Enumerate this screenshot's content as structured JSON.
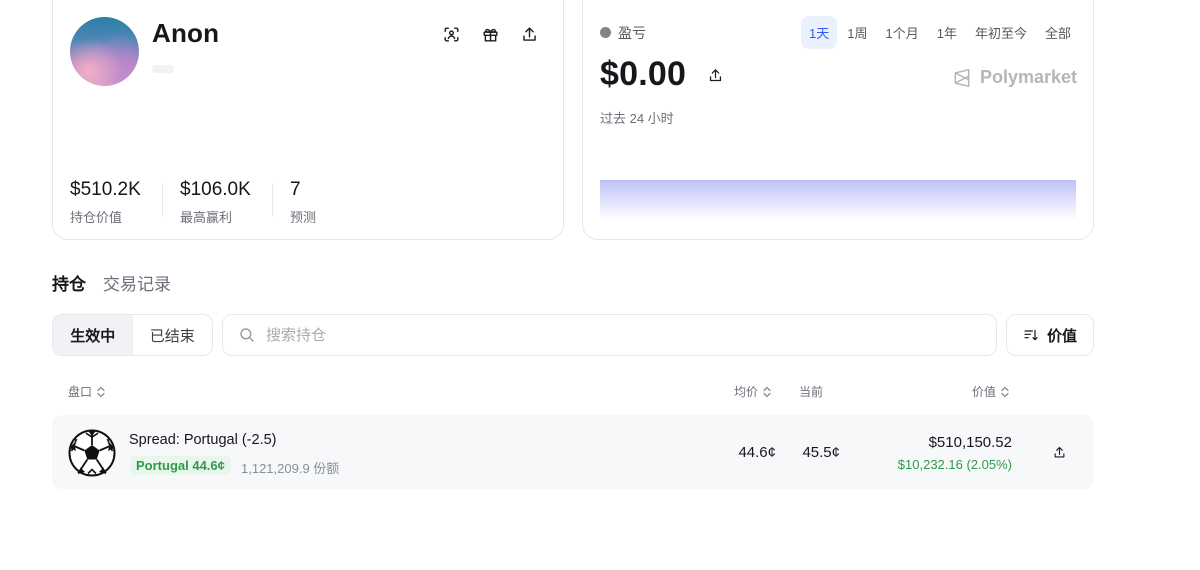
{
  "profile": {
    "username": "Anon",
    "stats": [
      {
        "value": "$510.2K",
        "label": "持仓价值"
      },
      {
        "value": "$106.0K",
        "label": "最高赢利"
      },
      {
        "value": "7",
        "label": "预测"
      }
    ]
  },
  "pnl": {
    "label": "盈亏",
    "value": "$0.00",
    "period": "过去 24 小时",
    "brand": "Polymarket",
    "ranges": [
      "1天",
      "1周",
      "1个月",
      "1年",
      "年初至今",
      "全部"
    ],
    "active_range": "1天",
    "chart_color": "#6f73e6"
  },
  "main_tabs": [
    "持仓",
    "交易记录"
  ],
  "filter": {
    "active_label": "生效中",
    "closed_label": "已结束",
    "search_placeholder": "搜索持仓",
    "sort_label": "价值"
  },
  "table": {
    "headers": {
      "market": "盘口",
      "avg": "均价",
      "current": "当前",
      "value": "价值"
    },
    "rows": [
      {
        "title": "Spread: Portugal (-2.5)",
        "outcome": "Portugal 44.6¢",
        "shares": "1,121,209.9 份额",
        "avg": "44.6¢",
        "current": "45.5¢",
        "value": "$510,150.52",
        "pnl": "$10,232.16 (2.05%)",
        "icon": "soccer-ball-icon"
      }
    ]
  },
  "colors": {
    "positive": "#2f9a4a",
    "active_tab_bg": "#eaf0fe",
    "active_tab_text": "#2f5bea"
  }
}
